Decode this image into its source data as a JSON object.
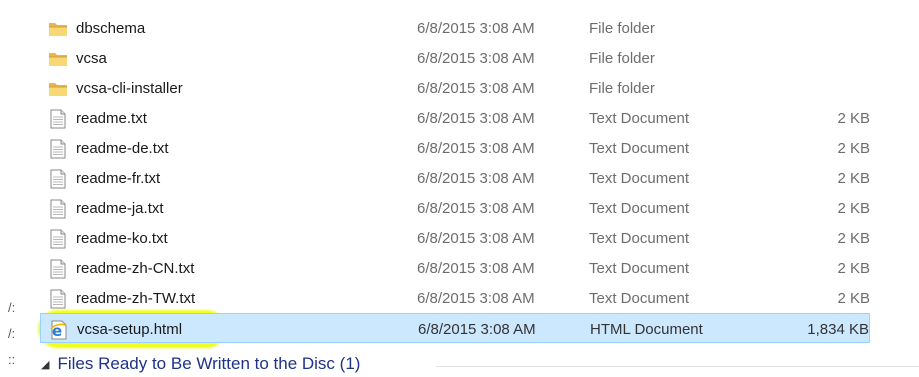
{
  "files": [
    {
      "name": "dbschema",
      "date": "6/8/2015 3:08 AM",
      "type": "File folder",
      "size": "",
      "icon": "folder-icon"
    },
    {
      "name": "vcsa",
      "date": "6/8/2015 3:08 AM",
      "type": "File folder",
      "size": "",
      "icon": "folder-icon"
    },
    {
      "name": "vcsa-cli-installer",
      "date": "6/8/2015 3:08 AM",
      "type": "File folder",
      "size": "",
      "icon": "folder-icon"
    },
    {
      "name": "readme.txt",
      "date": "6/8/2015 3:08 AM",
      "type": "Text Document",
      "size": "2 KB",
      "icon": "text-file-icon"
    },
    {
      "name": "readme-de.txt",
      "date": "6/8/2015 3:08 AM",
      "type": "Text Document",
      "size": "2 KB",
      "icon": "text-file-icon"
    },
    {
      "name": "readme-fr.txt",
      "date": "6/8/2015 3:08 AM",
      "type": "Text Document",
      "size": "2 KB",
      "icon": "text-file-icon"
    },
    {
      "name": "readme-ja.txt",
      "date": "6/8/2015 3:08 AM",
      "type": "Text Document",
      "size": "2 KB",
      "icon": "text-file-icon"
    },
    {
      "name": "readme-ko.txt",
      "date": "6/8/2015 3:08 AM",
      "type": "Text Document",
      "size": "2 KB",
      "icon": "text-file-icon"
    },
    {
      "name": "readme-zh-CN.txt",
      "date": "6/8/2015 3:08 AM",
      "type": "Text Document",
      "size": "2 KB",
      "icon": "text-file-icon"
    },
    {
      "name": "readme-zh-TW.txt",
      "date": "6/8/2015 3:08 AM",
      "type": "Text Document",
      "size": "2 KB",
      "icon": "text-file-icon"
    },
    {
      "name": "vcsa-setup.html",
      "date": "6/8/2015 3:08 AM",
      "type": "HTML Document",
      "size": "1,834 KB",
      "icon": "ie-html-icon",
      "selected": true
    }
  ],
  "group": {
    "label": "Files Ready to Be Written to the Disc (1)"
  },
  "colors": {
    "selection": "#cce8ff",
    "highlighter": "#f0ff00",
    "group_label": "#1e3287"
  }
}
